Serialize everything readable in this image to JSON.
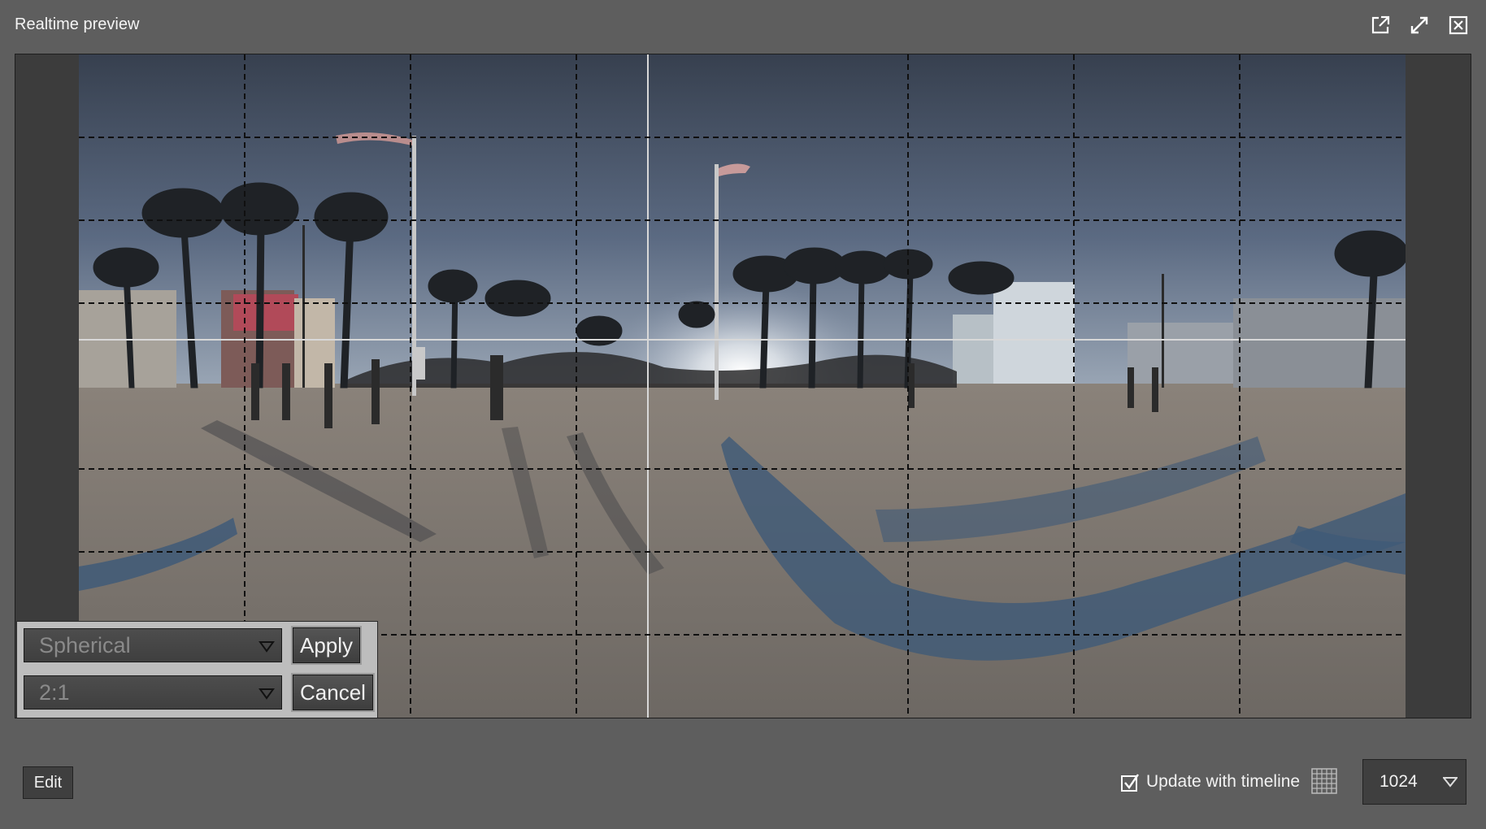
{
  "window": {
    "title": "Realtime preview",
    "buttons": [
      "pop-out-icon",
      "expand-icon",
      "close-icon"
    ]
  },
  "preview": {
    "projection_options": {
      "selected": "Spherical"
    },
    "aspect_options": {
      "selected": "2:1"
    },
    "apply_label": "Apply",
    "cancel_label": "Cancel"
  },
  "footer": {
    "edit_label": "Edit",
    "update_with_timeline_label": "Update with timeline",
    "update_with_timeline_checked": true,
    "resolution": "1024"
  },
  "colors": {
    "background": "#5e5e5e",
    "preview_bg": "#3c3c3c",
    "sky": "#3b4659",
    "ground": "#7d7670",
    "shadow_blue": "#3e5a78"
  }
}
